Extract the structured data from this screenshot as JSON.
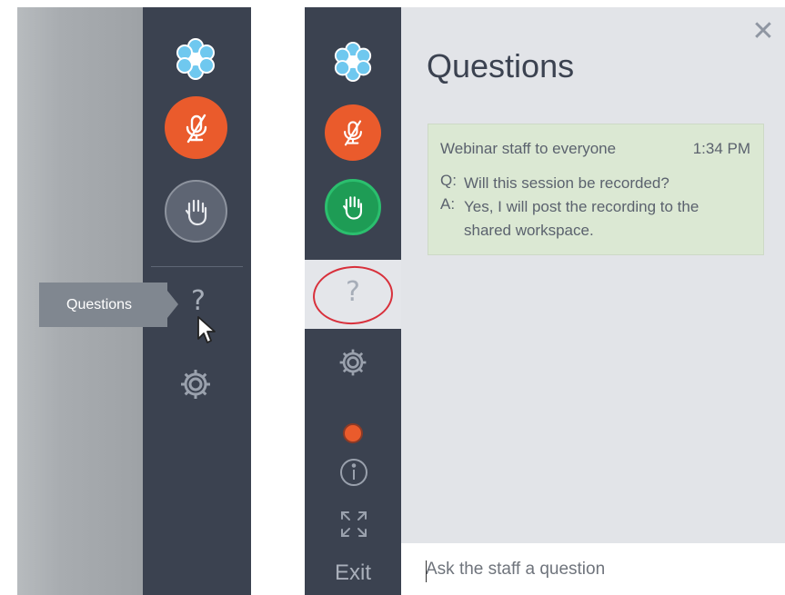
{
  "left_panel": {
    "tooltip_label": "Questions",
    "icons": [
      "citrix-logo-icon",
      "muted-mic-icon",
      "raise-hand-icon",
      "question-icon",
      "settings-gear-icon",
      "mouse-cursor-icon"
    ]
  },
  "right_panel": {
    "rail": {
      "question_glyph": "?",
      "exit_label": "Exit"
    },
    "main": {
      "title": "Questions",
      "close_glyph": "✕",
      "card": {
        "from": "Webinar staff to everyone",
        "time": "1:34 PM",
        "q_label": "Q:",
        "question": "Will this session be recorded?",
        "a_label": "A:",
        "answer": "Yes, I will post the recording to the shared workspace."
      },
      "input": {
        "placeholder": "Ask the staff a question"
      }
    }
  },
  "colors": {
    "rail": "#3b4250",
    "accent_orange": "#ea5b2c",
    "accent_green": "#1e9c55",
    "card_bg": "#dbe8d3",
    "annotation_red": "#d8303b"
  }
}
